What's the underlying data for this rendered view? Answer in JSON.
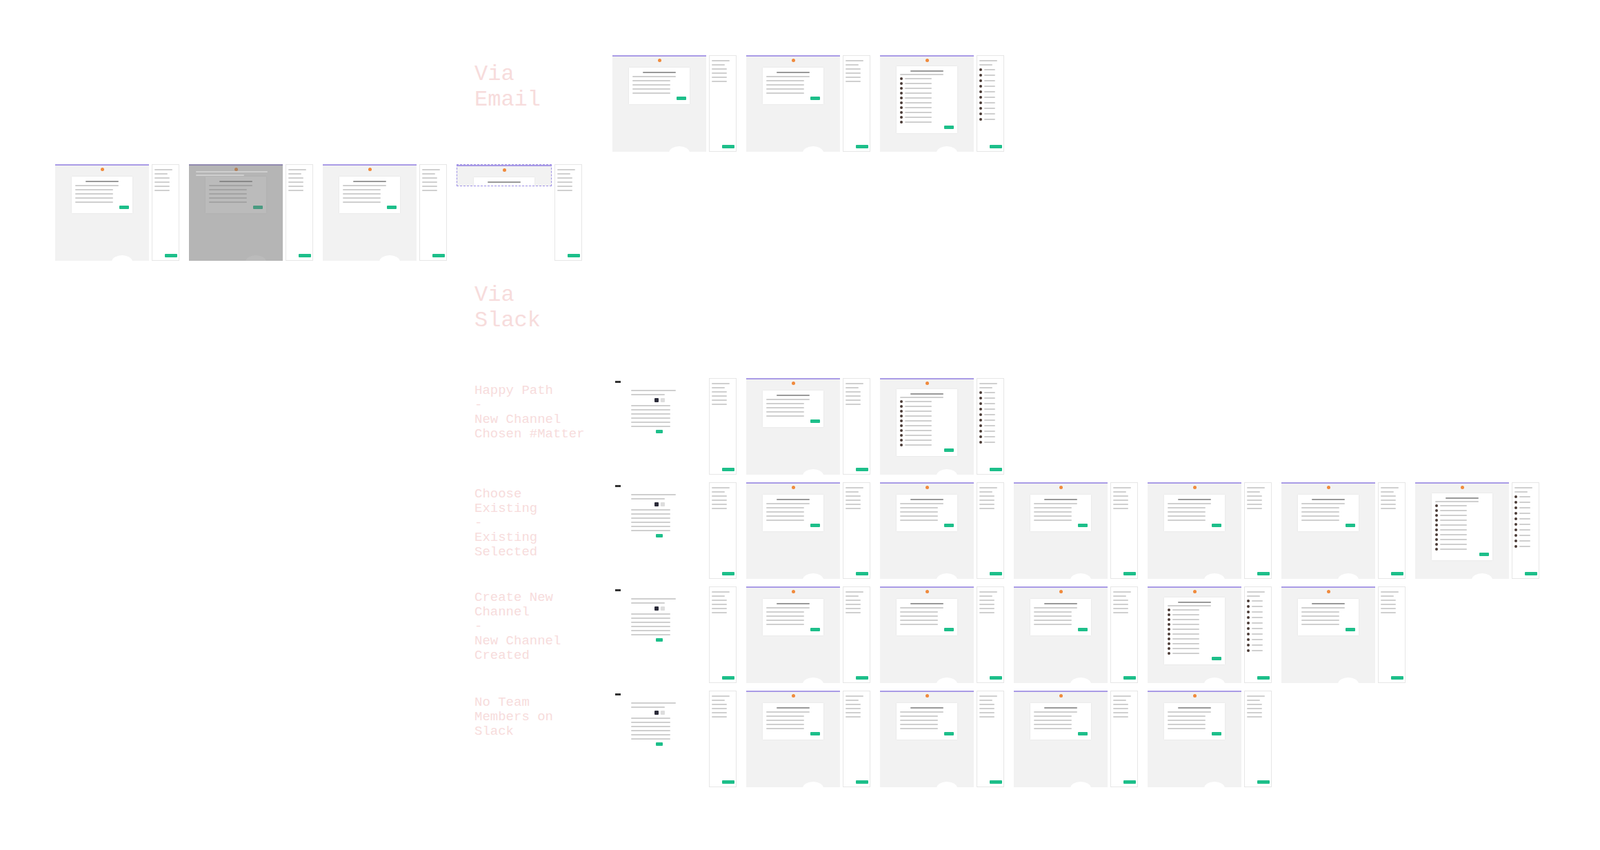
{
  "sections": [
    {
      "title": [
        "Via",
        "Email"
      ],
      "flows": [
        {
          "label": [],
          "frames": [
            "form",
            "form",
            "list"
          ]
        },
        {
          "label": [],
          "frames": [
            "form",
            "dialog",
            "form",
            "diagram"
          ]
        }
      ]
    },
    {
      "title": [
        "Via",
        "Slack"
      ],
      "flows": [
        {
          "label": [
            "Happy Path",
            "-",
            "New Channel",
            "Chosen #Matter"
          ],
          "frames": [
            "auth",
            "form",
            "list"
          ]
        },
        {
          "label": [
            "Choose",
            "Existing",
            "-",
            "Existing",
            "Selected"
          ],
          "frames": [
            "auth",
            "form",
            "form",
            "form",
            "form",
            "form",
            "list"
          ]
        },
        {
          "label": [
            "Create New",
            "Channel",
            "-",
            "New Channel",
            "Created"
          ],
          "frames": [
            "auth",
            "form",
            "form",
            "form",
            "list",
            "form"
          ]
        },
        {
          "label": [
            "No Team",
            "Members on",
            "Slack"
          ],
          "frames": [
            "auth",
            "form",
            "form",
            "form",
            "form"
          ]
        }
      ]
    }
  ]
}
